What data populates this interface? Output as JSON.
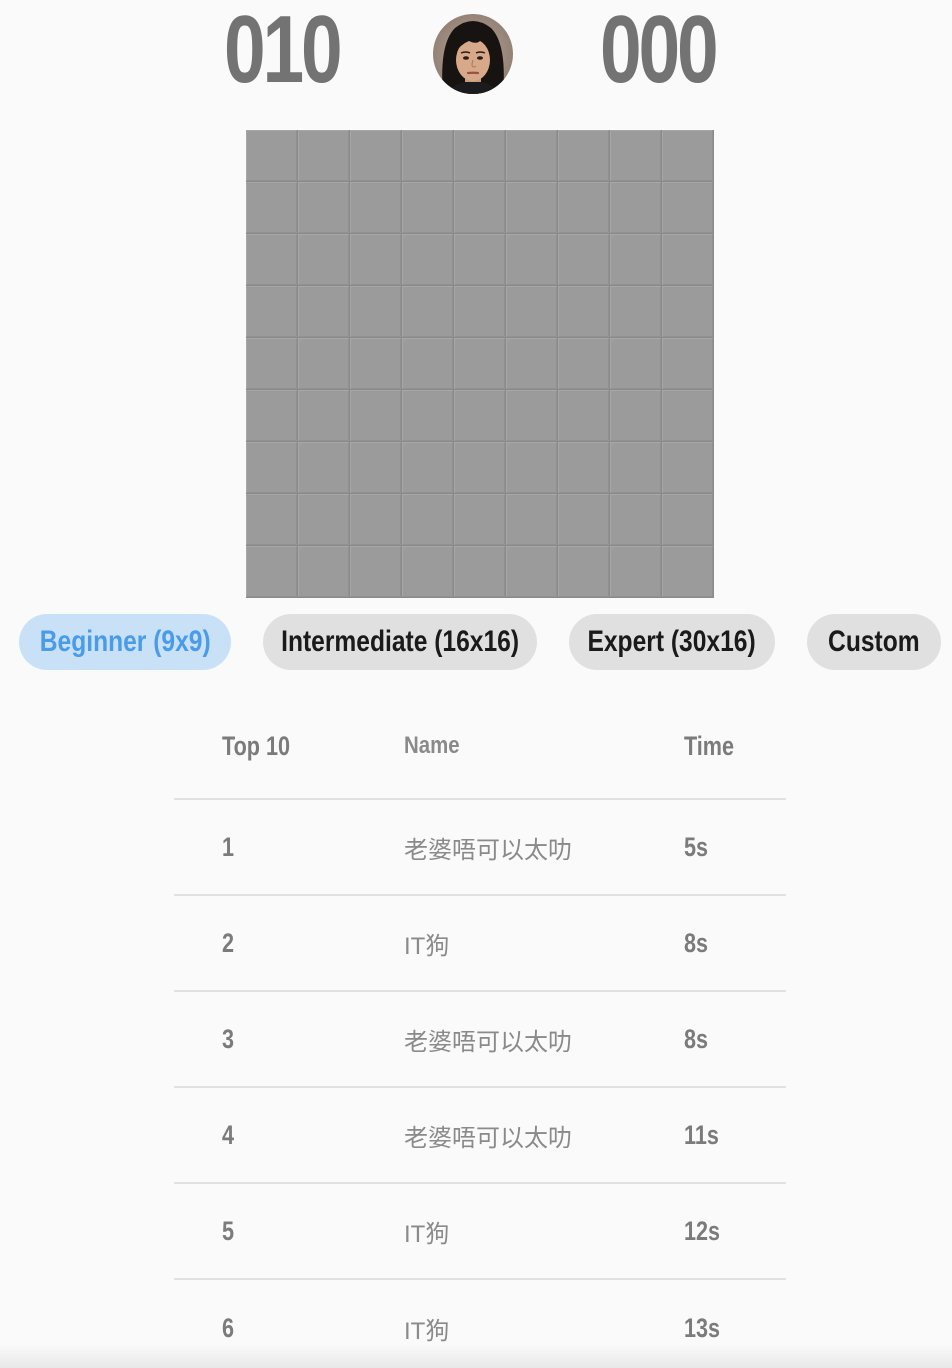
{
  "header": {
    "mine_counter": "010",
    "timer": "000",
    "face_icon": "player-face-avatar"
  },
  "board": {
    "columns": 9,
    "rows": 9,
    "state": "unrevealed"
  },
  "levels": [
    {
      "label": "Beginner (9x9)",
      "active": true
    },
    {
      "label": "Intermediate (16x16)",
      "active": false
    },
    {
      "label": "Expert (30x16)",
      "active": false
    },
    {
      "label": "Custom",
      "active": false
    }
  ],
  "colors": {
    "active_bg": "#c9e1f7",
    "active_text": "#4a9be8",
    "tile": "#9b9b9b",
    "counter": "#737373"
  },
  "leaderboard": {
    "headers": {
      "rank": "Top 10",
      "name": "Name",
      "time": "Time"
    },
    "rows": [
      {
        "rank": "1",
        "name": "老婆唔可以太叻",
        "time": "5s"
      },
      {
        "rank": "2",
        "name": "IT狗",
        "time": "8s"
      },
      {
        "rank": "3",
        "name": "老婆唔可以太叻",
        "time": "8s"
      },
      {
        "rank": "4",
        "name": "老婆唔可以太叻",
        "time": "11s"
      },
      {
        "rank": "5",
        "name": "IT狗",
        "time": "12s"
      },
      {
        "rank": "6",
        "name": "IT狗",
        "time": "13s"
      }
    ]
  }
}
